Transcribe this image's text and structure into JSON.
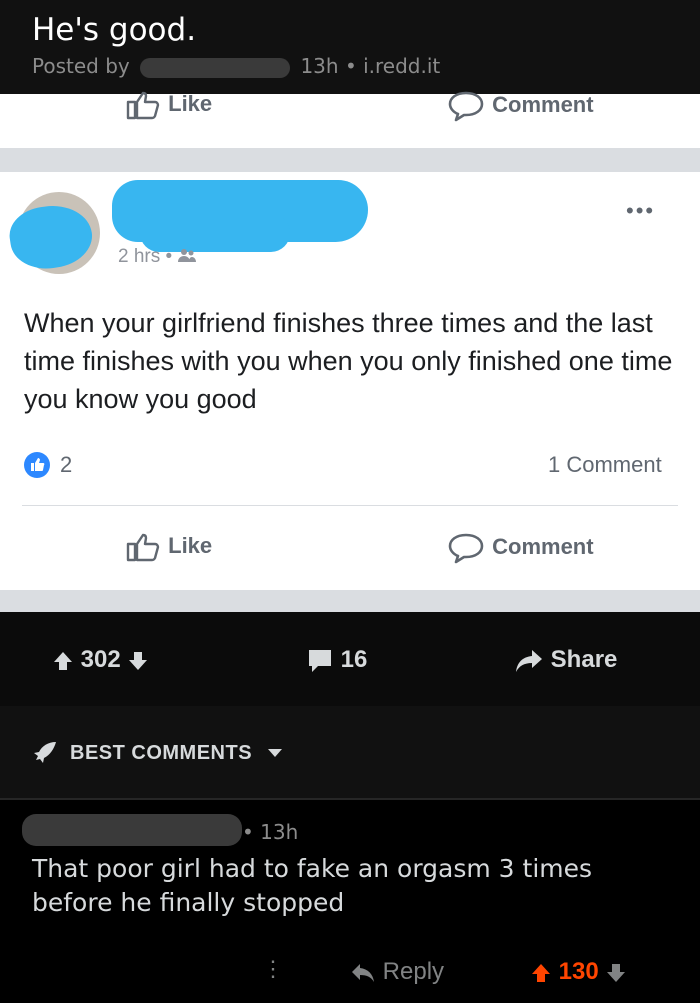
{
  "reddit": {
    "title": "He's good.",
    "posted_by": "Posted by",
    "age": "13h",
    "source": "i.redd.it",
    "upvotes": "302",
    "comments": "16",
    "share_label": "Share",
    "best_comments_label": "BEST COMMENTS"
  },
  "facebook": {
    "like_label": "Like",
    "comment_label": "Comment",
    "time": "2 hrs",
    "post_text": "When your girlfriend finishes three times and the last time finishes with you when you only finished one time you know you good",
    "likes": "2",
    "comment_count": "1 Comment"
  },
  "comment": {
    "age": "13h",
    "text": "That poor girl had to fake an orgasm 3 times before he finally stopped",
    "reply_label": "Reply",
    "score": "130"
  },
  "colors": {
    "fb_blue": "#2d88ff",
    "upvote_orange": "#ff4500",
    "redaction": "#38b6f0"
  },
  "icons": [
    "thumbs-up-icon",
    "comment-bubble-icon",
    "arrow-up-icon",
    "arrow-down-icon",
    "share-arrow-icon",
    "rocket-icon",
    "more-dots-icon"
  ]
}
